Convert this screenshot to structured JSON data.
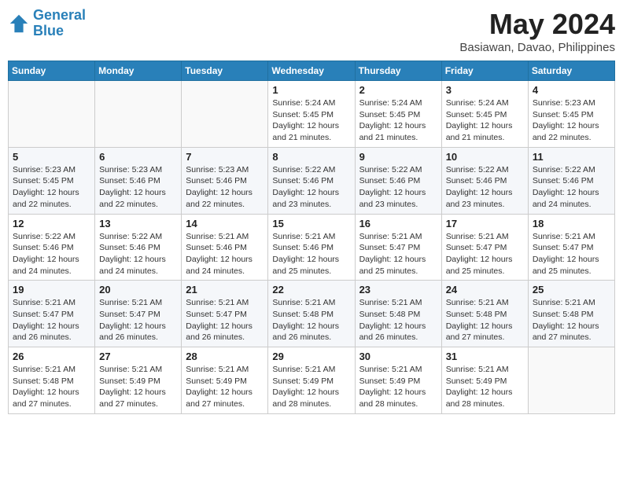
{
  "logo": {
    "line1": "General",
    "line2": "Blue"
  },
  "title": "May 2024",
  "location": "Basiawan, Davao, Philippines",
  "weekdays": [
    "Sunday",
    "Monday",
    "Tuesday",
    "Wednesday",
    "Thursday",
    "Friday",
    "Saturday"
  ],
  "weeks": [
    [
      {
        "day": "",
        "info": ""
      },
      {
        "day": "",
        "info": ""
      },
      {
        "day": "",
        "info": ""
      },
      {
        "day": "1",
        "info": "Sunrise: 5:24 AM\nSunset: 5:45 PM\nDaylight: 12 hours\nand 21 minutes."
      },
      {
        "day": "2",
        "info": "Sunrise: 5:24 AM\nSunset: 5:45 PM\nDaylight: 12 hours\nand 21 minutes."
      },
      {
        "day": "3",
        "info": "Sunrise: 5:24 AM\nSunset: 5:45 PM\nDaylight: 12 hours\nand 21 minutes."
      },
      {
        "day": "4",
        "info": "Sunrise: 5:23 AM\nSunset: 5:45 PM\nDaylight: 12 hours\nand 22 minutes."
      }
    ],
    [
      {
        "day": "5",
        "info": "Sunrise: 5:23 AM\nSunset: 5:45 PM\nDaylight: 12 hours\nand 22 minutes."
      },
      {
        "day": "6",
        "info": "Sunrise: 5:23 AM\nSunset: 5:46 PM\nDaylight: 12 hours\nand 22 minutes."
      },
      {
        "day": "7",
        "info": "Sunrise: 5:23 AM\nSunset: 5:46 PM\nDaylight: 12 hours\nand 22 minutes."
      },
      {
        "day": "8",
        "info": "Sunrise: 5:22 AM\nSunset: 5:46 PM\nDaylight: 12 hours\nand 23 minutes."
      },
      {
        "day": "9",
        "info": "Sunrise: 5:22 AM\nSunset: 5:46 PM\nDaylight: 12 hours\nand 23 minutes."
      },
      {
        "day": "10",
        "info": "Sunrise: 5:22 AM\nSunset: 5:46 PM\nDaylight: 12 hours\nand 23 minutes."
      },
      {
        "day": "11",
        "info": "Sunrise: 5:22 AM\nSunset: 5:46 PM\nDaylight: 12 hours\nand 24 minutes."
      }
    ],
    [
      {
        "day": "12",
        "info": "Sunrise: 5:22 AM\nSunset: 5:46 PM\nDaylight: 12 hours\nand 24 minutes."
      },
      {
        "day": "13",
        "info": "Sunrise: 5:22 AM\nSunset: 5:46 PM\nDaylight: 12 hours\nand 24 minutes."
      },
      {
        "day": "14",
        "info": "Sunrise: 5:21 AM\nSunset: 5:46 PM\nDaylight: 12 hours\nand 24 minutes."
      },
      {
        "day": "15",
        "info": "Sunrise: 5:21 AM\nSunset: 5:46 PM\nDaylight: 12 hours\nand 25 minutes."
      },
      {
        "day": "16",
        "info": "Sunrise: 5:21 AM\nSunset: 5:47 PM\nDaylight: 12 hours\nand 25 minutes."
      },
      {
        "day": "17",
        "info": "Sunrise: 5:21 AM\nSunset: 5:47 PM\nDaylight: 12 hours\nand 25 minutes."
      },
      {
        "day": "18",
        "info": "Sunrise: 5:21 AM\nSunset: 5:47 PM\nDaylight: 12 hours\nand 25 minutes."
      }
    ],
    [
      {
        "day": "19",
        "info": "Sunrise: 5:21 AM\nSunset: 5:47 PM\nDaylight: 12 hours\nand 26 minutes."
      },
      {
        "day": "20",
        "info": "Sunrise: 5:21 AM\nSunset: 5:47 PM\nDaylight: 12 hours\nand 26 minutes."
      },
      {
        "day": "21",
        "info": "Sunrise: 5:21 AM\nSunset: 5:47 PM\nDaylight: 12 hours\nand 26 minutes."
      },
      {
        "day": "22",
        "info": "Sunrise: 5:21 AM\nSunset: 5:48 PM\nDaylight: 12 hours\nand 26 minutes."
      },
      {
        "day": "23",
        "info": "Sunrise: 5:21 AM\nSunset: 5:48 PM\nDaylight: 12 hours\nand 26 minutes."
      },
      {
        "day": "24",
        "info": "Sunrise: 5:21 AM\nSunset: 5:48 PM\nDaylight: 12 hours\nand 27 minutes."
      },
      {
        "day": "25",
        "info": "Sunrise: 5:21 AM\nSunset: 5:48 PM\nDaylight: 12 hours\nand 27 minutes."
      }
    ],
    [
      {
        "day": "26",
        "info": "Sunrise: 5:21 AM\nSunset: 5:48 PM\nDaylight: 12 hours\nand 27 minutes."
      },
      {
        "day": "27",
        "info": "Sunrise: 5:21 AM\nSunset: 5:49 PM\nDaylight: 12 hours\nand 27 minutes."
      },
      {
        "day": "28",
        "info": "Sunrise: 5:21 AM\nSunset: 5:49 PM\nDaylight: 12 hours\nand 27 minutes."
      },
      {
        "day": "29",
        "info": "Sunrise: 5:21 AM\nSunset: 5:49 PM\nDaylight: 12 hours\nand 28 minutes."
      },
      {
        "day": "30",
        "info": "Sunrise: 5:21 AM\nSunset: 5:49 PM\nDaylight: 12 hours\nand 28 minutes."
      },
      {
        "day": "31",
        "info": "Sunrise: 5:21 AM\nSunset: 5:49 PM\nDaylight: 12 hours\nand 28 minutes."
      },
      {
        "day": "",
        "info": ""
      }
    ]
  ]
}
